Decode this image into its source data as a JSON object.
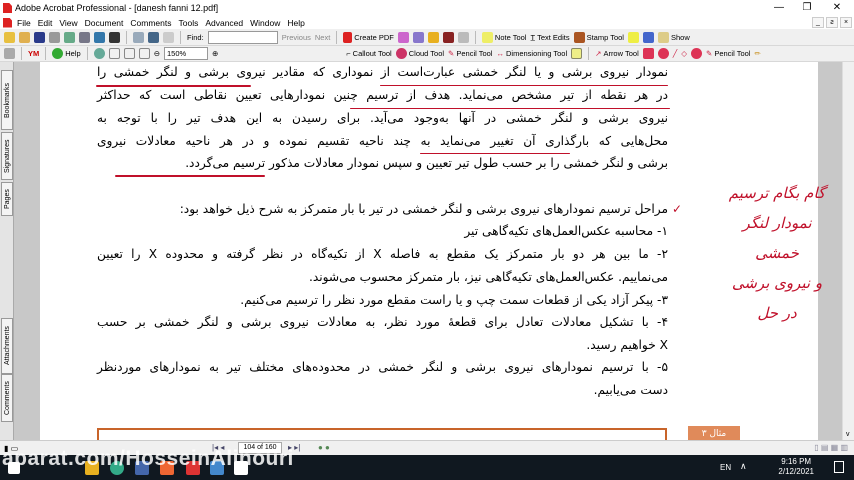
{
  "window": {
    "title": "Adobe Acrobat Professional - [danesh fanni 12.pdf]",
    "min": "—",
    "max": "❐",
    "close": "✕",
    "doc_controls": [
      "_",
      "ƨ",
      "×"
    ]
  },
  "menu": [
    "File",
    "Edit",
    "View",
    "Document",
    "Comments",
    "Tools",
    "Advanced",
    "Window",
    "Help"
  ],
  "toolbar1": {
    "find_label": "Find:",
    "find_value": "",
    "previous": "Previous",
    "next": "Next",
    "create_pdf": "Create PDF",
    "note_tool": "Note Tool",
    "text_edits": "Text Edits",
    "stamp_tool": "Stamp Tool",
    "show": "Show"
  },
  "toolbar2": {
    "help": "Help",
    "zoom": "150%",
    "callout_tool": "Callout Tool",
    "cloud_tool": "Cloud Tool",
    "pencil_tool": "Pencil Tool",
    "dimensioning_tool": "Dimensioning Tool",
    "arrow_tool": "Arrow Tool",
    "pencil_tool2": "Pencil Tool"
  },
  "side_tabs": [
    "Bookmarks",
    "Signatures",
    "Pages",
    "Attachments",
    "Comments"
  ],
  "document": {
    "paragraph": [
      "نمودار نیروی برشی و یا لنگر خمشی عبارت‌است از نموداری که مقادیر نیروی برشی و لنگر خمشی را",
      "در هر نقطه از تیر مشخص می‌نماید. هدف از ترسیم چنین نمودارهایی تعیین نقاطی است که حداکثر",
      "نیروی برشی و لنگر خمشی در آنها به‌وجود می‌آید. برای رسیدن به این هدف تیر را با توجه به",
      "محل‌هایی که بارگذاری آن تغییر می‌نماید به چند ناحیه تقسیم نموده و در هر ناحیه معادلات نیروی",
      "برشی و لنگر خمشی را بر حسب طول تیر تعیین و سپس نمودار معادلات مذکور ترسیم می‌گردد."
    ],
    "steps_intro": "مراحل ترسیم نمودارهای نیروی برشی و لنگر خمشی در تیر با بار متمرکز به شرح ذیل خواهد بود:",
    "steps": [
      "۱- محاسبه عکس‌العمل‌های تکیه‌گاهی تیر",
      "۲- ما بین هر دو بار متمرکز یک مقطع به فاصله X از تکیه‌گاه در نظر گرفته و محدوده X را تعیین",
      "می‌نماییم. عکس‌العمل‌های تکیه‌گاهی نیز، بار متمرکز محسوب می‌شوند.",
      "۳- پیکر آزاد یکی از قطعات سمت چپ و یا راست مقطع مورد نظر را ترسیم می‌کنیم.",
      "۴- با تشکیل معادلات تعادل برای قطعهٔ مورد نظر، به معادلات نیروی برشی و لنگر خمشی بر حسب",
      "X خواهیم رسید.",
      "۵- با ترسیم نمودارهای نیروی برشی و لنگر خمشی در محدوده‌های مختلف تیر به نمودارهای موردنظر",
      "دست  می‌یابیم."
    ],
    "handwritten": [
      "گام بگام ترسیم",
      "نمودار لنگر خمشی",
      "و نیروی برشی",
      "در حل"
    ],
    "example_tag": "مثال ۳"
  },
  "statusbar": {
    "page": "104 of 160"
  },
  "taskbar": {
    "watermark": "aparat.com/HosseinAlinouri",
    "lang": "EN",
    "time": "9:16 PM",
    "date": "2/12/2021"
  },
  "colors": {
    "annotation": "#c0102a",
    "example": "#c8642a",
    "taskbar": "#101820"
  }
}
